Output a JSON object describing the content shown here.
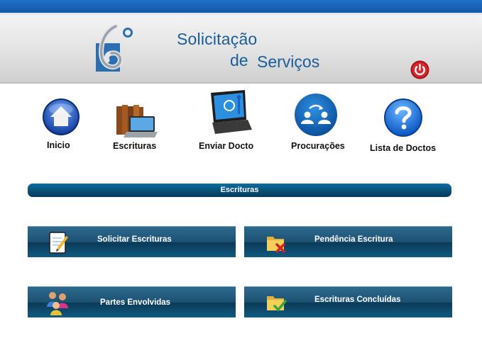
{
  "header": {
    "title_line1": "Solicitação",
    "title_line2_a": "de",
    "title_line2_b": "Serviços"
  },
  "nav": {
    "inicio": "Inicio",
    "escrituras": "Escrituras",
    "enviar": "Enviar Docto",
    "procuracoes": "Procurações",
    "lista": "Lista de Doctos"
  },
  "section": {
    "title": "Escrituras"
  },
  "tiles": {
    "solicitar": "Solicitar Escrituras",
    "pendencia": "Pendência Escritura",
    "partes": "Partes Envolvidas",
    "concluidas": "Escrituras Concluídas"
  },
  "colors": {
    "brand_blue": "#1b5d9a",
    "tile_blue": "#1c5172",
    "power_red": "#d7262c"
  }
}
